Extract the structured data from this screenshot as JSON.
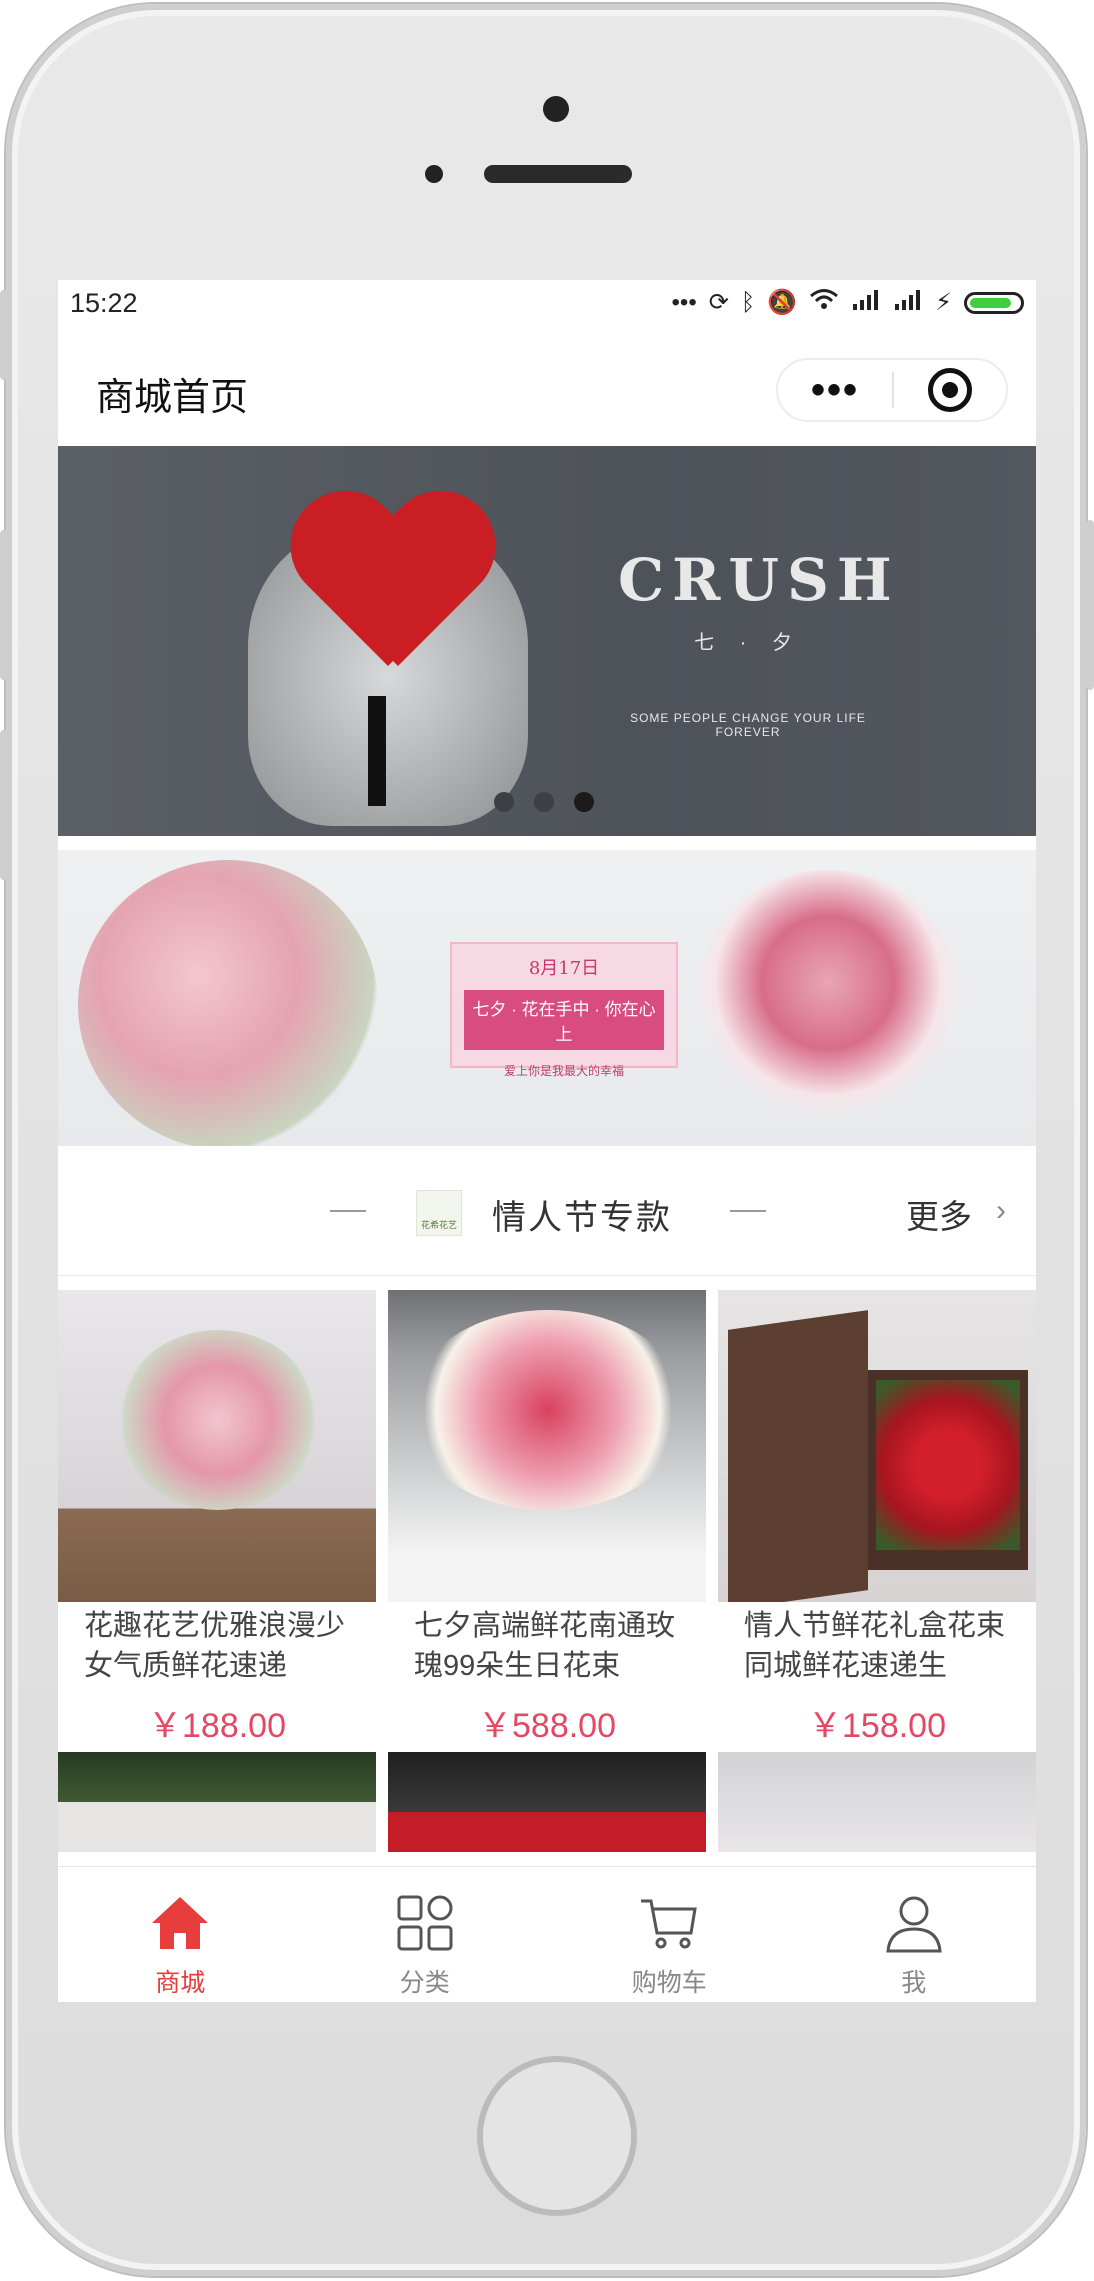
{
  "status_bar": {
    "time": "15:22",
    "icons": [
      "ellipsis-icon",
      "sync-icon",
      "bluetooth-icon",
      "mute-icon",
      "wifi-icon",
      "signal-icon",
      "signal-icon",
      "charging-icon",
      "battery-icon"
    ]
  },
  "nav": {
    "title": "商城首页",
    "capsule_more": "•••"
  },
  "banner": {
    "brand": "CRUSH",
    "subtitle": "七 · 夕",
    "tagline": "SOME PEOPLE CHANGE YOUR LIFE FOREVER",
    "slide_count": 3,
    "active_slide": 3
  },
  "promo": {
    "date": "8月17日",
    "slogan": "七夕 · 花在手中 · 你在心上",
    "small": "爱上你是我最大的幸福"
  },
  "section": {
    "logo_text": "花希花艺",
    "title": "情人节专款",
    "more": "更多"
  },
  "products": [
    {
      "name": "花趣花艺优雅浪漫少女气质鲜花速递",
      "price": "￥188.00"
    },
    {
      "name": "七夕高端鲜花南通玫瑰99朵生日花束",
      "price": "￥588.00"
    },
    {
      "name": "情人节鲜花礼盒花束同城鲜花速递生",
      "price": "￥158.00"
    }
  ],
  "tabbar": {
    "items": [
      {
        "label": "商城",
        "icon": "home-icon",
        "active": true
      },
      {
        "label": "分类",
        "icon": "category-icon",
        "active": false
      },
      {
        "label": "购物车",
        "icon": "cart-icon",
        "active": false
      },
      {
        "label": "我",
        "icon": "user-icon",
        "active": false
      }
    ],
    "active_color": "#e83d3d",
    "inactive_color": "#888888"
  }
}
